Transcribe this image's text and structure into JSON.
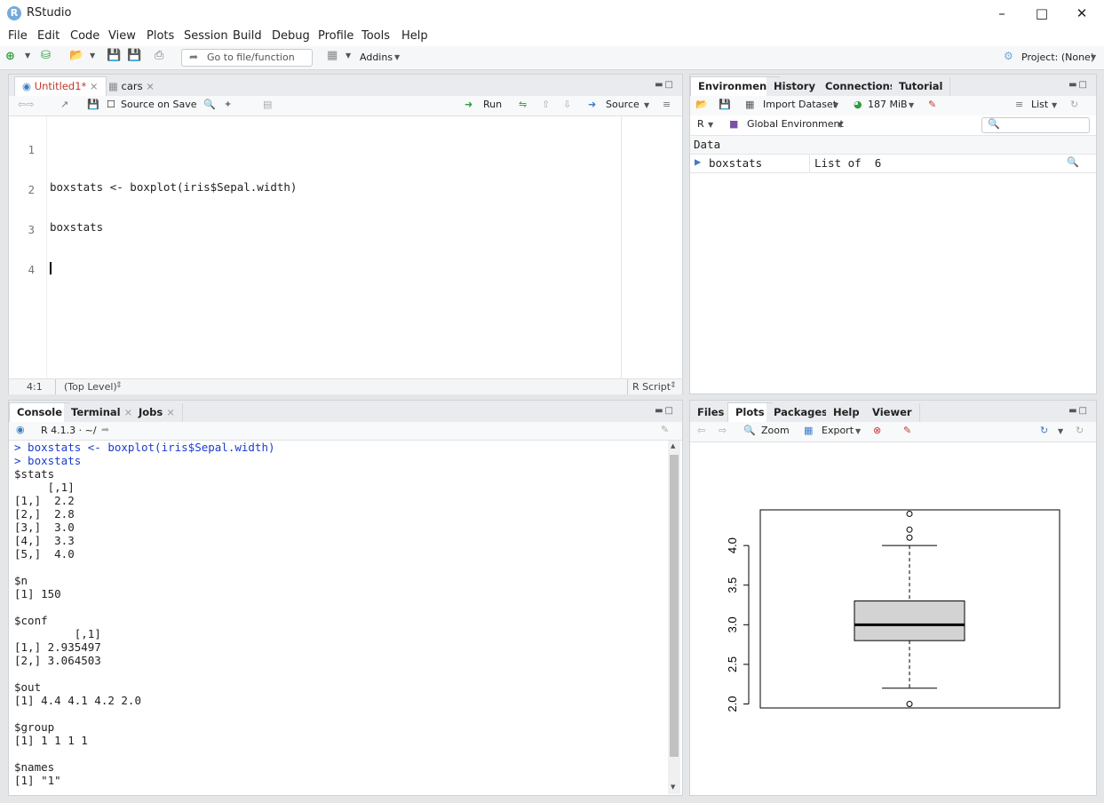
{
  "window": {
    "title": "RStudio"
  },
  "menu": [
    "File",
    "Edit",
    "Code",
    "View",
    "Plots",
    "Session",
    "Build",
    "Debug",
    "Profile",
    "Tools",
    "Help"
  ],
  "toolbar": {
    "goto_placeholder": "Go to file/function",
    "addins": "Addins",
    "project": "Project: (None)"
  },
  "editor": {
    "tabs": [
      "Untitled1*",
      "cars"
    ],
    "source_on_save": "Source on Save",
    "run": "Run",
    "source": "Source",
    "lines": [
      "",
      "boxstats <- boxplot(iris$Sepal.width)",
      "boxstats",
      ""
    ],
    "line_numbers": [
      "1",
      "2",
      "3",
      "4"
    ],
    "status_pos": "4:1",
    "status_scope": "(Top Level)",
    "status_type": "R Script"
  },
  "console": {
    "tabs": [
      "Console",
      "Terminal",
      "Jobs"
    ],
    "version": "R 4.1.3 · ~/",
    "lines": [
      {
        "text": "> boxstats <- boxplot(iris$Sepal.width)",
        "type": "input"
      },
      {
        "text": "> boxstats",
        "type": "input"
      },
      {
        "text": "$stats",
        "type": "out"
      },
      {
        "text": "     [,1]",
        "type": "out"
      },
      {
        "text": "[1,]  2.2",
        "type": "out"
      },
      {
        "text": "[2,]  2.8",
        "type": "out"
      },
      {
        "text": "[3,]  3.0",
        "type": "out"
      },
      {
        "text": "[4,]  3.3",
        "type": "out"
      },
      {
        "text": "[5,]  4.0",
        "type": "out"
      },
      {
        "text": "",
        "type": "out"
      },
      {
        "text": "$n",
        "type": "out"
      },
      {
        "text": "[1] 150",
        "type": "out"
      },
      {
        "text": "",
        "type": "out"
      },
      {
        "text": "$conf",
        "type": "out"
      },
      {
        "text": "         [,1]",
        "type": "out"
      },
      {
        "text": "[1,] 2.935497",
        "type": "out"
      },
      {
        "text": "[2,] 3.064503",
        "type": "out"
      },
      {
        "text": "",
        "type": "out"
      },
      {
        "text": "$out",
        "type": "out"
      },
      {
        "text": "[1] 4.4 4.1 4.2 2.0",
        "type": "out"
      },
      {
        "text": "",
        "type": "out"
      },
      {
        "text": "$group",
        "type": "out"
      },
      {
        "text": "[1] 1 1 1 1",
        "type": "out"
      },
      {
        "text": "",
        "type": "out"
      },
      {
        "text": "$names",
        "type": "out"
      },
      {
        "text": "[1] \"1\"",
        "type": "out"
      }
    ]
  },
  "environment": {
    "tabs": [
      "Environment",
      "History",
      "Connections",
      "Tutorial"
    ],
    "import_dataset": "Import Dataset",
    "memory": "187 MiB",
    "view_mode": "List",
    "language": "R",
    "scope": "Global Environment",
    "section": "Data",
    "rows": [
      {
        "name": "boxstats",
        "value": "List of  6"
      }
    ]
  },
  "files": {
    "tabs": [
      "Files",
      "Plots",
      "Packages",
      "Help",
      "Viewer"
    ],
    "zoom": "Zoom",
    "export": "Export"
  },
  "chart_data": {
    "type": "box",
    "stats": {
      "whisker_low": 2.2,
      "q1": 2.8,
      "median": 3.0,
      "q3": 3.3,
      "whisker_high": 4.0
    },
    "outliers": [
      4.4,
      4.1,
      4.2,
      2.0
    ],
    "yticks": [
      "2.0",
      "2.5",
      "3.0",
      "3.5",
      "4.0"
    ],
    "ylim": [
      1.95,
      4.45
    ],
    "box_fill": "#d3d3d3"
  }
}
